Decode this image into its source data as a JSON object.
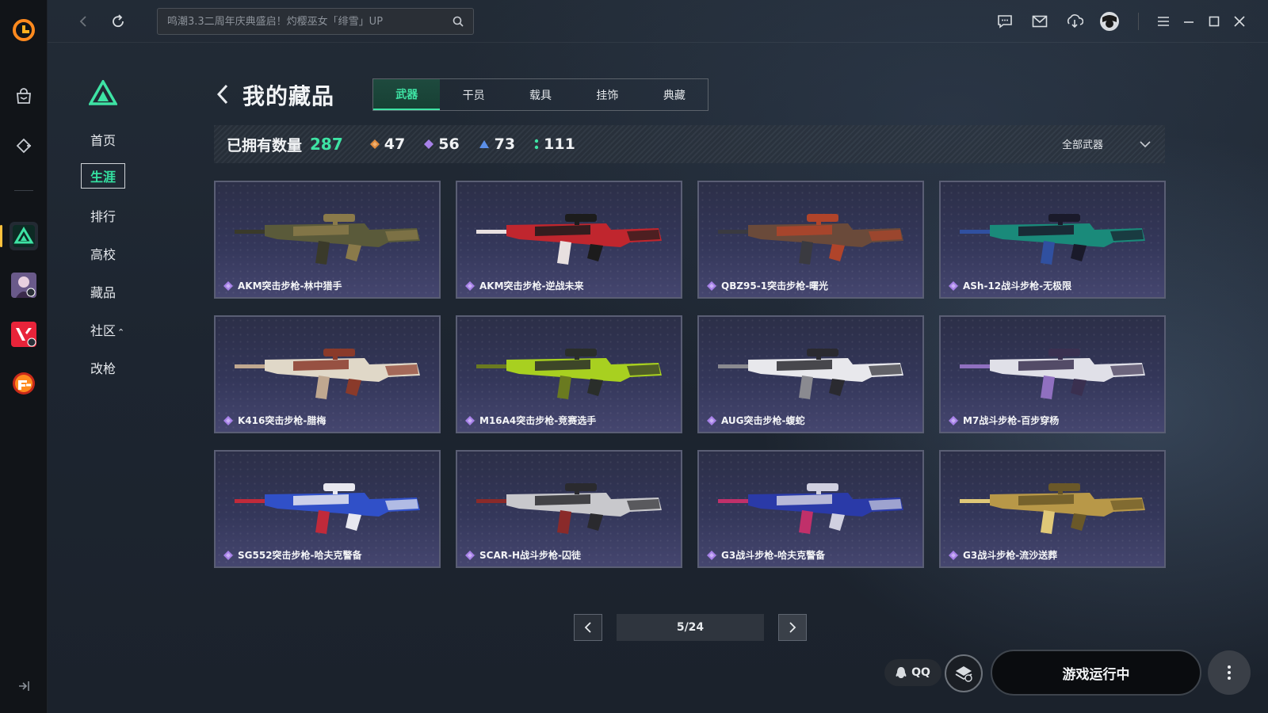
{
  "titlebar": {
    "search_placeholder": "鸣潮3.3二周年庆典盛启！灼樱巫女「绯雪」UP"
  },
  "game_nav": {
    "items": [
      {
        "label": "首页"
      },
      {
        "label": "生涯",
        "selected": true
      },
      {
        "label": "排行"
      },
      {
        "label": "高校"
      },
      {
        "label": "藏品"
      },
      {
        "label": "社区",
        "suffix": "⌃"
      },
      {
        "label": "改枪"
      }
    ]
  },
  "header": {
    "title": "我的藏品",
    "tabs": [
      {
        "label": "武器",
        "active": true
      },
      {
        "label": "干员"
      },
      {
        "label": "载具"
      },
      {
        "label": "挂饰"
      },
      {
        "label": "典藏"
      }
    ]
  },
  "stats": {
    "owned_label": "已拥有数量",
    "owned_total": "287",
    "rarities": [
      {
        "count": "47",
        "color": "#e08a3c"
      },
      {
        "count": "56",
        "color": "#a781e8"
      },
      {
        "count": "73",
        "color": "#5b8fe8"
      },
      {
        "count": "111",
        "color": "#3ee3a4"
      }
    ],
    "filter_value": "全部武器"
  },
  "items": [
    {
      "name": "AKM突击步枪-林中猎手",
      "colors": [
        "#5a5a3a",
        "#8a7a4a",
        "#3a3a2a"
      ]
    },
    {
      "name": "AKM突击步枪-逆战未来",
      "colors": [
        "#c0262e",
        "#1c1c1c",
        "#e8e0e0"
      ]
    },
    {
      "name": "QBZ95-1突击步枪-曙光",
      "colors": [
        "#6a4a3a",
        "#b0442a",
        "#3a3a40"
      ]
    },
    {
      "name": "ASh-12战斗步枪-无极限",
      "colors": [
        "#1a8a7a",
        "#1a1a2a",
        "#3050a0"
      ]
    },
    {
      "name": "K416突击步枪-腊梅",
      "colors": [
        "#e0d8c8",
        "#8a3a2a",
        "#c0a890"
      ]
    },
    {
      "name": "M16A4突击步枪-竞赛选手",
      "colors": [
        "#a8d020",
        "#2a2e2a",
        "#6a7a20"
      ]
    },
    {
      "name": "AUG突击步枪-蝮蛇",
      "colors": [
        "#e8e8ec",
        "#2a2a30",
        "#8a8a90"
      ]
    },
    {
      "name": "M7战斗步枪-百步穿杨",
      "colors": [
        "#e0e0e8",
        "#3a3050",
        "#9070c0"
      ]
    },
    {
      "name": "SG552突击步枪-哈夫克警备",
      "colors": [
        "#3050c8",
        "#e8e8f0",
        "#c02a3a"
      ]
    },
    {
      "name": "SCAR-H战斗步枪-囚徒",
      "colors": [
        "#c8c8cc",
        "#2a2a2e",
        "#8a2a2a"
      ]
    },
    {
      "name": "G3战斗步枪-哈夫克警备",
      "colors": [
        "#2a3aa8",
        "#d0d0e0",
        "#c0306a"
      ]
    },
    {
      "name": "G3战斗步枪-流沙送葬",
      "colors": [
        "#b89848",
        "#6a5828",
        "#e0c878"
      ]
    }
  ],
  "pagination": {
    "current": 5,
    "total": 24,
    "label": "5/24"
  },
  "bottom": {
    "qq_label": "QQ",
    "launch_label": "游戏运行中"
  }
}
